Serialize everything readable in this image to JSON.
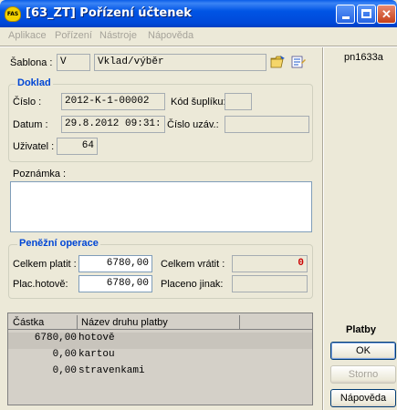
{
  "window": {
    "app_icon_text": "FAS",
    "title": "[63_ZT] Pořízení účtenek",
    "minimize": "_",
    "maximize": "□",
    "close": "✕"
  },
  "menu": [
    "Aplikace",
    "Pořízení",
    "Nástroje",
    "Nápověda"
  ],
  "template": {
    "label": "Šablona :",
    "code": "V",
    "name": "Vklad/výběr"
  },
  "user_code": "pn1633a",
  "doklad": {
    "title": "Doklad",
    "cislo_label": "Číslo :",
    "cislo": "2012-K-1-00002",
    "kod_suplik_label": "Kód šuplíku:",
    "kod_suplik": "",
    "datum_label": "Datum :",
    "datum": "29.8.2012 09:31:",
    "cislo_uzav_label": "Číslo uzáv.:",
    "cislo_uzav": "",
    "uzivatel_label": "Uživatel :",
    "uzivatel": "64"
  },
  "poznamka": {
    "label": "Poznámka :",
    "value": ""
  },
  "penezni": {
    "title": "Peněžní operace",
    "celkem_platit_label": "Celkem platit :",
    "celkem_platit": "6780,00",
    "celkem_vratit_label": "Celkem vrátit :",
    "celkem_vratit": "0",
    "plac_hotove_label": "Plac.hotově:",
    "plac_hotove": "6780,00",
    "placeno_jinak_label": "Placeno jinak:",
    "placeno_jinak": ""
  },
  "payments": {
    "columns": [
      "Částka",
      "Název druhu platby"
    ],
    "rows": [
      {
        "amount": "6780,00",
        "type": "hotově"
      },
      {
        "amount": "0,00",
        "type": "kartou"
      },
      {
        "amount": "0,00",
        "type": "stravenkami"
      }
    ]
  },
  "side": {
    "title": "Platby",
    "ok": "OK",
    "storno": "Storno",
    "help": "Nápověda"
  },
  "colors": {
    "accent": "#0046d5",
    "alert": "#cc0000"
  }
}
